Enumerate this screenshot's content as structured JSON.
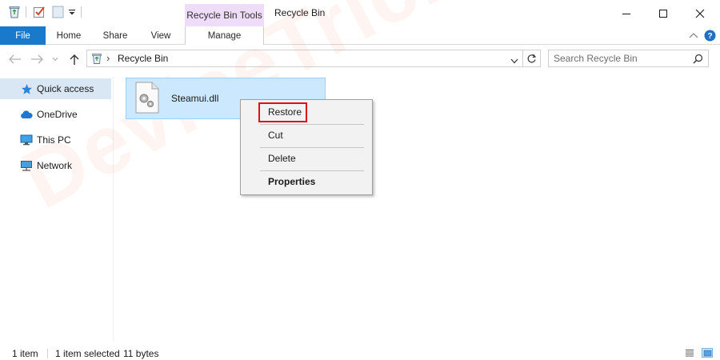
{
  "window": {
    "title": "Recycle Bin",
    "contextual_tab_group": "Recycle Bin Tools",
    "controls": [
      "minimize-icon",
      "maximize-icon",
      "close-icon"
    ]
  },
  "quick_access_toolbar": {
    "icons": [
      "recycle-bin-icon",
      "properties-check-icon",
      "new-folder-icon",
      "customize-dropdown-icon"
    ]
  },
  "ribbon": {
    "tabs": [
      {
        "label": "File",
        "active": true
      },
      {
        "label": "Home"
      },
      {
        "label": "Share"
      },
      {
        "label": "View"
      },
      {
        "label": "Manage"
      }
    ]
  },
  "address_bar": {
    "path": "Recycle Bin",
    "separator": "›"
  },
  "search": {
    "placeholder": "Search Recycle Bin"
  },
  "sidebar": {
    "items": [
      {
        "label": "Quick access",
        "icon": "star-icon",
        "selected": true
      },
      {
        "label": "OneDrive",
        "icon": "cloud-icon"
      },
      {
        "label": "This PC",
        "icon": "computer-icon"
      },
      {
        "label": "Network",
        "icon": "network-icon"
      }
    ]
  },
  "content": {
    "files": [
      {
        "name": "Steamui.dll",
        "icon": "dll-gear-file-icon",
        "selected": true
      }
    ]
  },
  "context_menu": {
    "items": [
      {
        "label": "Restore",
        "highlighted": true
      },
      {
        "label": "Cut"
      },
      {
        "label": "Delete"
      },
      {
        "label": "Properties",
        "bold": true
      }
    ]
  },
  "watermark": {
    "text": "DeviceTricks"
  },
  "statusbar": {
    "item_count": "1 item",
    "selection": "1 item selected",
    "size": "11 bytes"
  },
  "colors": {
    "file_tab": "#1979ca",
    "selection_fill": "#cce8ff",
    "selection_border": "#99d1ff",
    "contextual_tab": "#efdcf8",
    "highlight_box": "#e01010"
  }
}
